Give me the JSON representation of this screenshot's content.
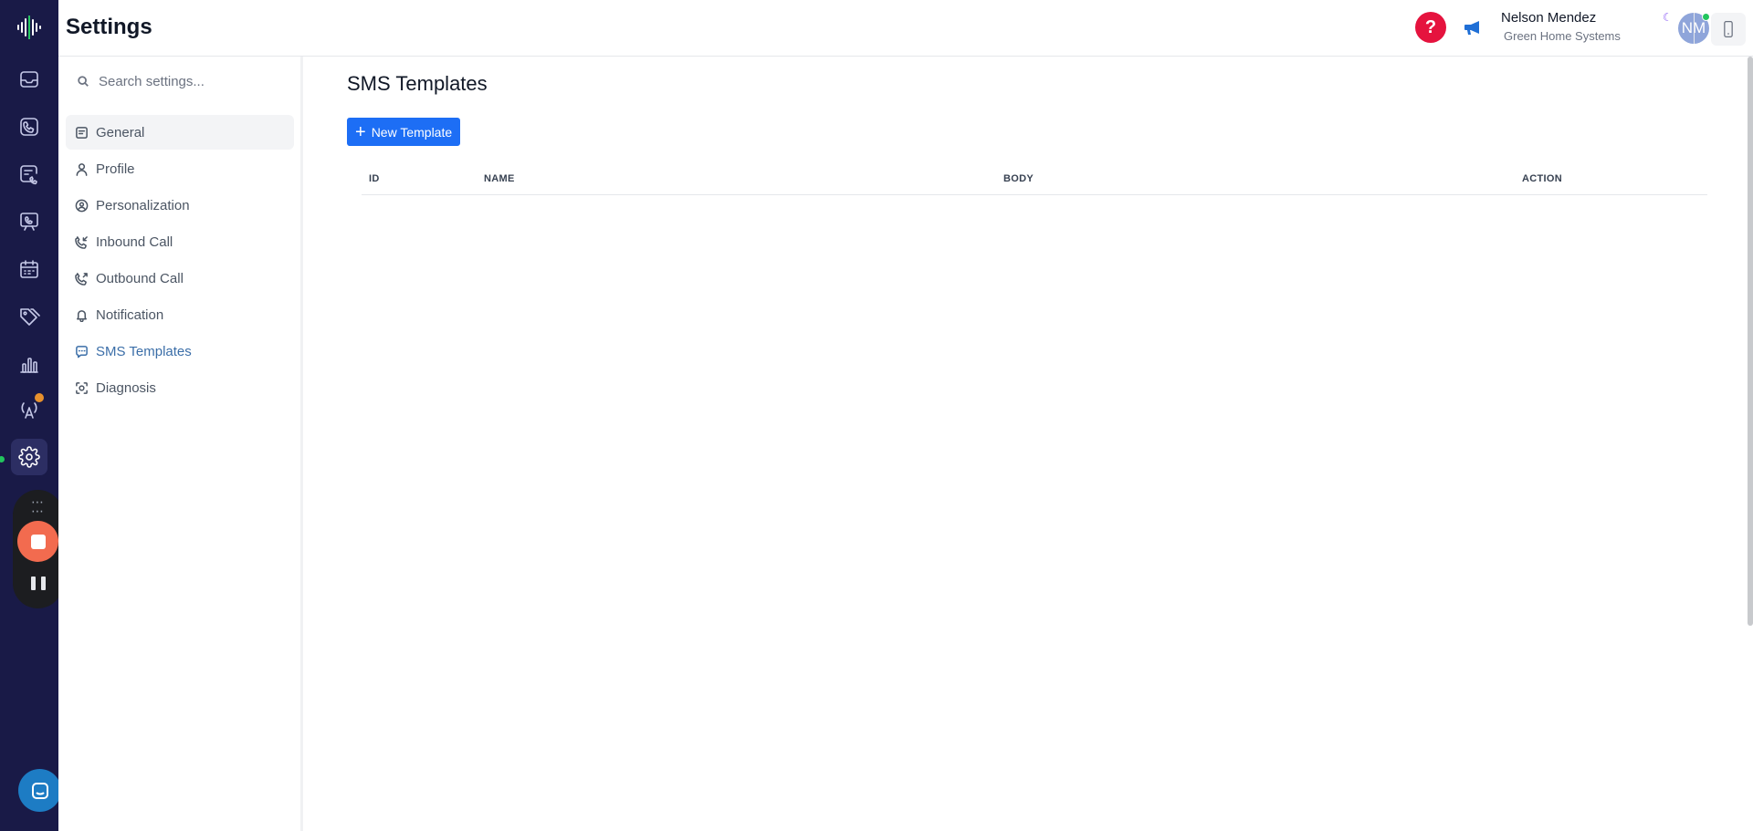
{
  "header": {
    "title": "Settings",
    "help_label": "?",
    "user": {
      "name": "Nelson Mendez",
      "organization": "Green Home Systems",
      "initials": "NM"
    }
  },
  "rail": {
    "items": [
      "logo-icon",
      "inbox-icon",
      "phone-icon",
      "call-log-icon",
      "kiosk-icon",
      "calendar-icon",
      "tags-icon",
      "analytics-icon",
      "broadcast-icon",
      "settings-icon"
    ],
    "active": "settings-icon"
  },
  "settings_nav": {
    "search_placeholder": "Search settings...",
    "items": [
      {
        "label": "General",
        "icon": "general-icon"
      },
      {
        "label": "Profile",
        "icon": "profile-icon"
      },
      {
        "label": "Personalization",
        "icon": "personalization-icon"
      },
      {
        "label": "Inbound Call",
        "icon": "inbound-call-icon"
      },
      {
        "label": "Outbound Call",
        "icon": "outbound-call-icon"
      },
      {
        "label": "Notification",
        "icon": "bell-icon"
      },
      {
        "label": "SMS Templates",
        "icon": "sms-icon"
      },
      {
        "label": "Diagnosis",
        "icon": "diagnosis-icon"
      }
    ],
    "active": "SMS Templates"
  },
  "main": {
    "section_title": "SMS Templates",
    "new_button_label": "New Template",
    "table": {
      "columns": [
        "ID",
        "NAME",
        "BODY",
        "ACTION"
      ],
      "rows": []
    }
  },
  "colors": {
    "rail_bg": "#191a47",
    "primary_button": "#1d6ef5",
    "help_red": "#e5133e",
    "record_stop": "#f26b4f",
    "active_nav": "#3b6ea8"
  }
}
